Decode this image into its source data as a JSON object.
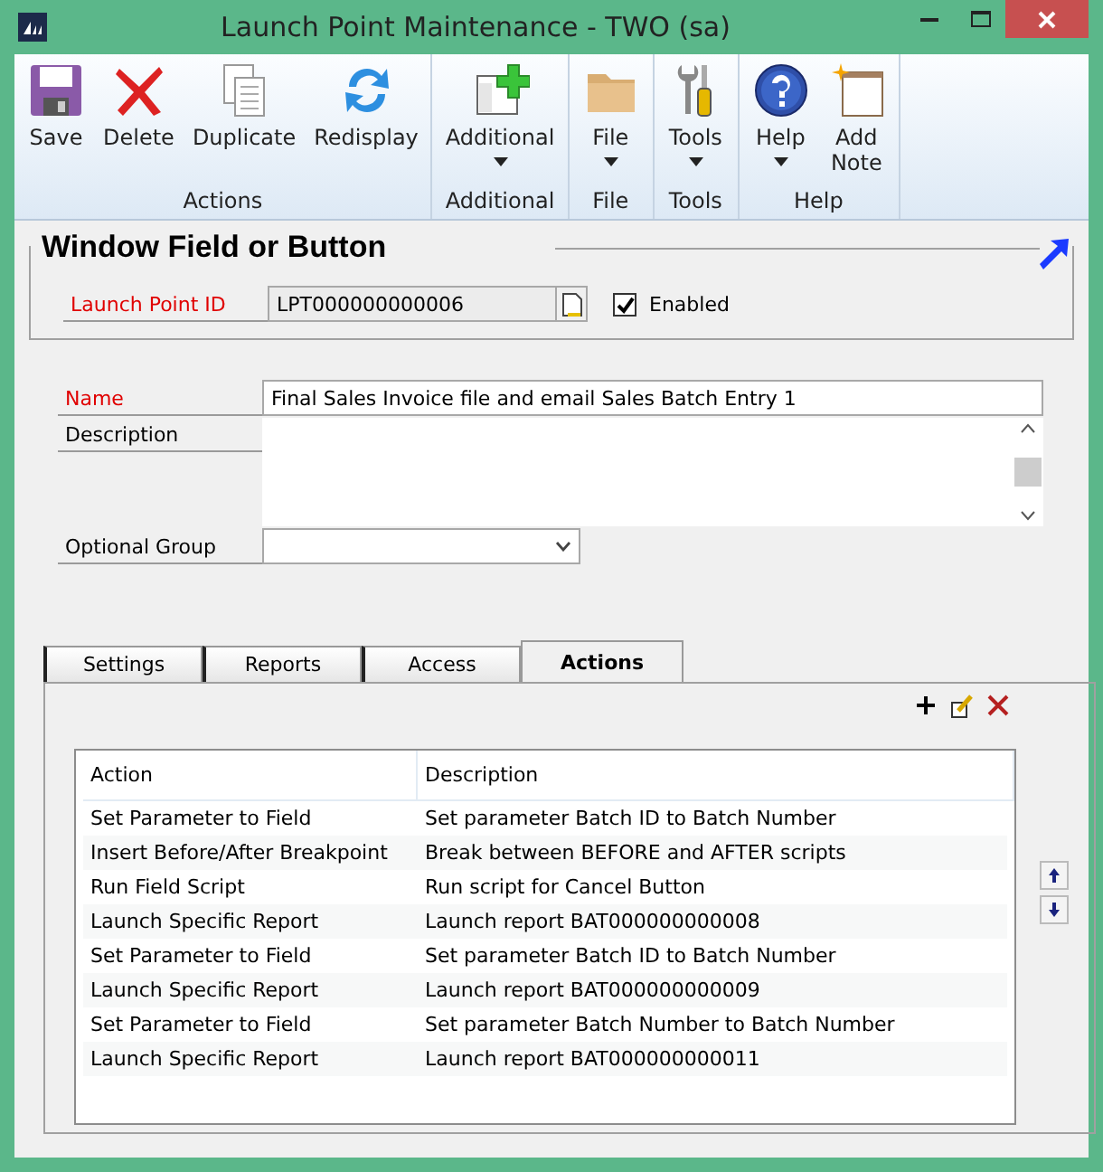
{
  "window": {
    "title": "Launch Point Maintenance  -  TWO (sa)"
  },
  "ribbon": [
    {
      "label": "Actions",
      "items": [
        {
          "label": "Save",
          "kind": "save",
          "dropdown": false
        },
        {
          "label": "Delete",
          "kind": "delete",
          "dropdown": false
        },
        {
          "label": "Duplicate",
          "kind": "duplicate",
          "dropdown": false
        },
        {
          "label": "Redisplay",
          "kind": "redisplay",
          "dropdown": false
        }
      ]
    },
    {
      "label": "Additional",
      "items": [
        {
          "label": "Additional",
          "kind": "additional",
          "dropdown": true
        }
      ]
    },
    {
      "label": "File",
      "items": [
        {
          "label": "File",
          "kind": "file",
          "dropdown": true
        }
      ]
    },
    {
      "label": "Tools",
      "items": [
        {
          "label": "Tools",
          "kind": "tools",
          "dropdown": true
        }
      ]
    },
    {
      "label": "Help",
      "items": [
        {
          "label": "Help",
          "kind": "help",
          "dropdown": true
        },
        {
          "label": "Add\nNote",
          "kind": "note",
          "dropdown": false
        }
      ]
    }
  ],
  "header": {
    "title": "Window Field or Button",
    "id_label": "Launch Point  ID",
    "id_value": "LPT000000000006",
    "enabled": {
      "label": "Enabled",
      "checked": true
    }
  },
  "form": {
    "name_label": "Name",
    "name_value": "Final Sales Invoice file and email Sales Batch Entry 1",
    "description_label": "Description",
    "group_label": "Optional Group"
  },
  "tabs": [
    {
      "label": "Settings",
      "selected": false
    },
    {
      "label": "Reports",
      "selected": false
    },
    {
      "label": "Access",
      "selected": false
    },
    {
      "label": "Actions",
      "selected": true
    }
  ],
  "table": {
    "columns": [
      "Action",
      "Description"
    ],
    "rows": [
      [
        "Set Parameter to Field",
        "Set parameter Batch ID to Batch Number"
      ],
      [
        "Insert Before/After Breakpoint",
        "Break between BEFORE and AFTER scripts"
      ],
      [
        "Run Field Script",
        "Run script for Cancel Button"
      ],
      [
        "Launch Specific Report",
        "Launch report BAT000000000008"
      ],
      [
        "Set Parameter to Field",
        "Set parameter Batch ID to Batch Number"
      ],
      [
        "Launch Specific Report",
        "Launch report BAT000000000009"
      ],
      [
        "Set Parameter to Field",
        "Set parameter Batch Number to Batch Number"
      ],
      [
        "Launch Specific Report",
        "Launch report BAT000000000011"
      ]
    ]
  }
}
